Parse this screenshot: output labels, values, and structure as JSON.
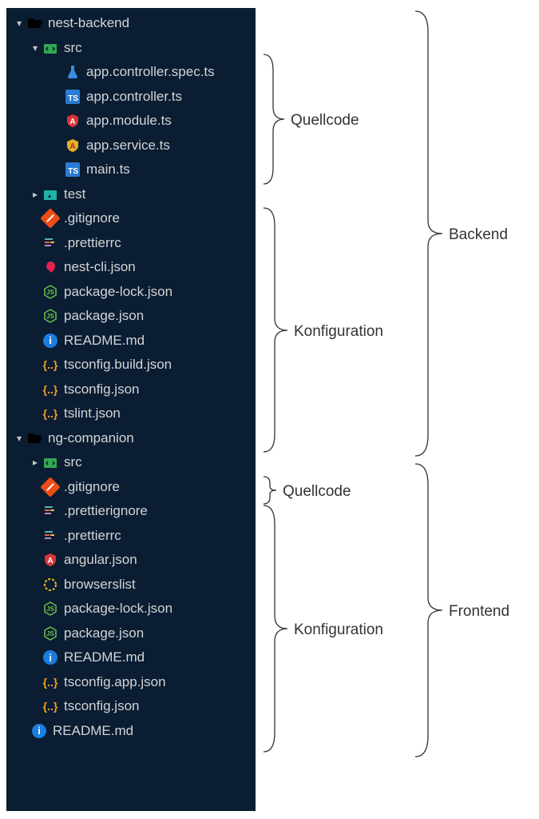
{
  "tree": {
    "nest_backend": "nest-backend",
    "src": "src",
    "app_controller_spec": "app.controller.spec.ts",
    "app_controller": "app.controller.ts",
    "app_module": "app.module.ts",
    "app_service": "app.service.ts",
    "main_ts": "main.ts",
    "test": "test",
    "gitignore": ".gitignore",
    "prettierrc": ".prettierrc",
    "nest_cli_json": "nest-cli.json",
    "package_lock": "package-lock.json",
    "package_json": "package.json",
    "readme": "README.md",
    "tsconfig_build": "tsconfig.build.json",
    "tsconfig": "tsconfig.json",
    "tslint": "tslint.json",
    "ng_companion": "ng-companion",
    "src2": "src",
    "gitignore2": ".gitignore",
    "prettierignore": ".prettierignore",
    "prettierrc2": ".prettierrc",
    "angular_json": "angular.json",
    "browserslist": "browserslist",
    "package_lock2": "package-lock.json",
    "package_json2": "package.json",
    "readme2": "README.md",
    "tsconfig_app": "tsconfig.app.json",
    "tsconfig2": "tsconfig.json",
    "readme_root": "README.md"
  },
  "labels": {
    "quellcode": "Quellcode",
    "konfiguration": "Konfiguration",
    "backend": "Backend",
    "frontend": "Frontend"
  }
}
